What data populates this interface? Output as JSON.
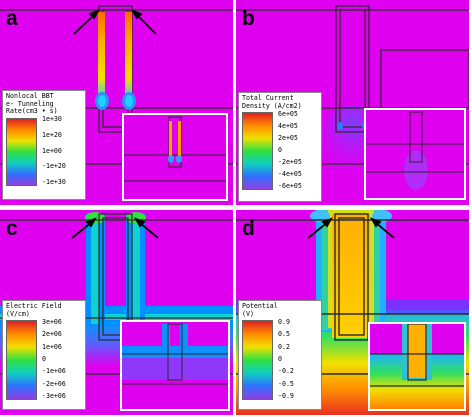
{
  "panels": [
    {
      "id": "a",
      "label": "a",
      "legend_title": [
        "Nonlocal BBT",
        "e- Tunneling",
        "Rate(cm3 • s)"
      ],
      "ticks": [
        "1e+30",
        "1e+20",
        "1e+00",
        "-1e+20",
        "-1e+30"
      ]
    },
    {
      "id": "b",
      "label": "b",
      "legend_title": [
        "Total Current",
        "Density (A/cm2)"
      ],
      "ticks": [
        "6e+05",
        "4e+05",
        "2e+05",
        "0",
        "-2e+05",
        "-4e+05",
        "-6e+05"
      ]
    },
    {
      "id": "c",
      "label": "c",
      "legend_title": [
        "Electric Field",
        "(V/cm)"
      ],
      "ticks": [
        "3e+06",
        "2e+06",
        "1e+06",
        "0",
        "-1e+06",
        "-2e+06",
        "-3e+06"
      ]
    },
    {
      "id": "d",
      "label": "d",
      "legend_title": [
        "Potential",
        "(V)"
      ],
      "ticks": [
        "0.9",
        "0.5",
        "0.2",
        "0",
        "-0.2",
        "-0.5",
        "-0.9"
      ]
    }
  ],
  "colors": {
    "background": "#e000f0",
    "outline": "#2a2a2a",
    "arrow": "#000000",
    "scale_top": "#e02020",
    "scale_bottom": "#a040d0"
  }
}
